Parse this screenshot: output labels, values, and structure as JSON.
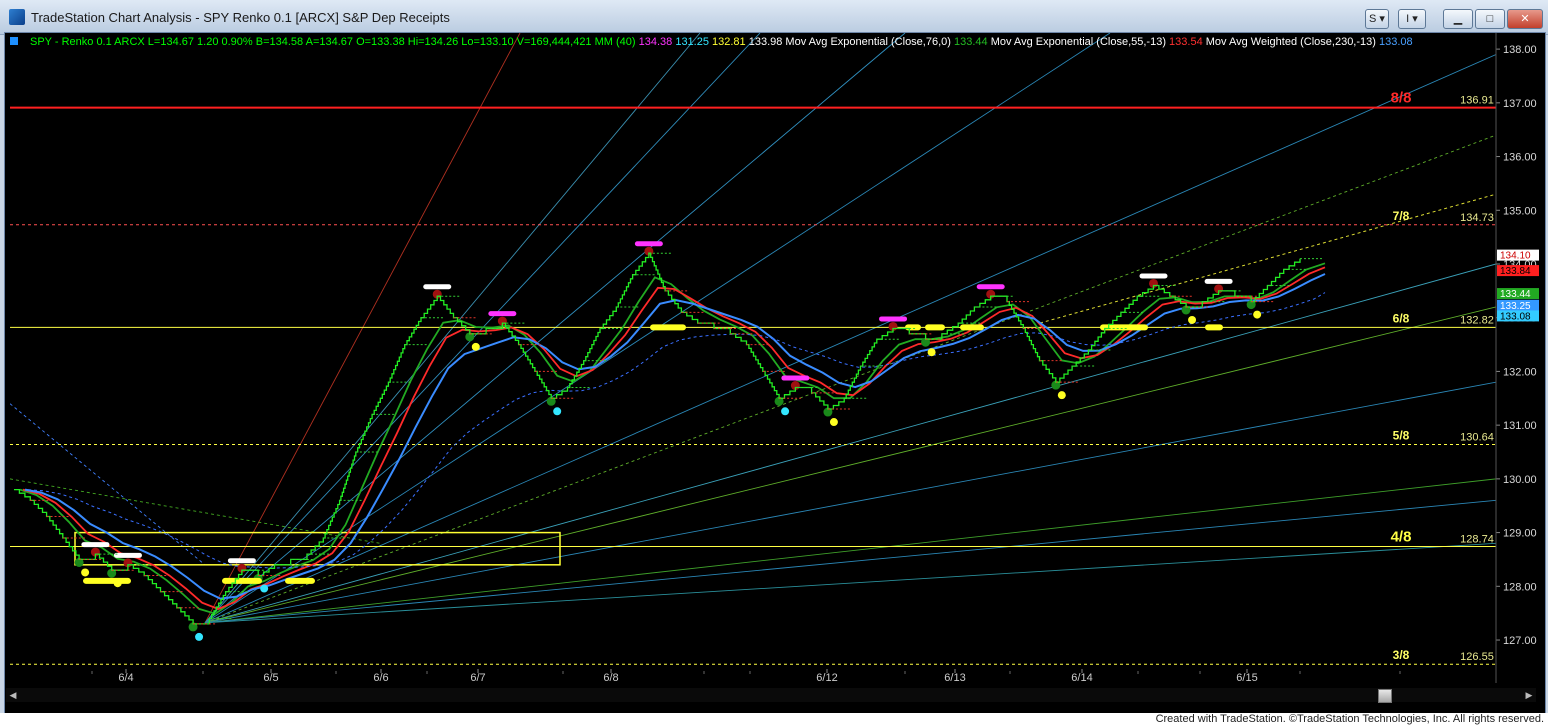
{
  "window": {
    "title": "TradeStation Chart Analysis - SPY Renko 0.1 [ARCX] S&P Dep Receipts",
    "btn_s": "S",
    "btn_i": "I",
    "btn_minimize": "▁",
    "btn_maximize": "□",
    "btn_close": "✕"
  },
  "header": {
    "items": [
      {
        "text": "SPY - Renko 0.1  ARCX  L=134.67  1.20  0.90%  B=134.58  A=134.67  O=133.38  Hi=134.26  Lo=133.10  V=169,444,421  MM (40)",
        "color": "#00ff00"
      },
      {
        "text": "134.38",
        "color": "#ff33ff"
      },
      {
        "text": "131.25",
        "color": "#33e6ff"
      },
      {
        "text": "132.81",
        "color": "#ffff33"
      },
      {
        "text": "133.98",
        "color": "#ffffff"
      },
      {
        "text": "Mov Avg Exponential (Close,76,0)",
        "color": "#ffffff"
      },
      {
        "text": "133.44",
        "color": "#22bb22"
      },
      {
        "text": "Mov Avg Exponential (Close,55,-13)",
        "color": "#ffffff"
      },
      {
        "text": "133.54",
        "color": "#ff3030"
      },
      {
        "text": "Mov Avg Weighted (Close,230,-13)",
        "color": "#ffffff"
      },
      {
        "text": "133.08",
        "color": "#4aa0ff"
      }
    ]
  },
  "murrey": [
    {
      "label": "8/8",
      "value": "136.91",
      "price": 136.91,
      "color": "#ff2020",
      "dash": "0",
      "width": 2,
      "label_color": "#ff2a2a",
      "label_size": 15
    },
    {
      "label": "7/8",
      "value": "134.73",
      "price": 134.73,
      "color": "#ff5050",
      "dash": "3,3",
      "width": 1,
      "label_color": "#ffff66",
      "label_size": 12
    },
    {
      "label": "6/8",
      "value": "132.82",
      "price": 132.82,
      "color": "#ffff44",
      "dash": "0",
      "width": 1,
      "label_color": "#ffff66",
      "label_size": 12
    },
    {
      "label": "5/8",
      "value": "130.64",
      "price": 130.64,
      "color": "#ffff44",
      "dash": "3,3",
      "width": 1,
      "label_color": "#ffff66",
      "label_size": 12
    },
    {
      "label": "4/8",
      "value": "128.74",
      "price": 128.74,
      "color": "#ffff44",
      "dash": "0",
      "width": 1,
      "label_color": "#ffff44",
      "label_size": 15
    },
    {
      "label": "3/8",
      "value": "126.55",
      "price": 126.55,
      "color": "#ffff44",
      "dash": "3,3",
      "width": 1,
      "label_color": "#ffff66",
      "label_size": 12
    }
  ],
  "chart_data": {
    "type": "line",
    "ylim": [
      126.2,
      138.3
    ],
    "y_ticks": [
      "127.00",
      "128.00",
      "129.00",
      "130.00",
      "131.00",
      "132.00",
      "133.00",
      "134.00",
      "135.00",
      "136.00",
      "137.00",
      "138.00"
    ],
    "x_ticks": [
      "6/4",
      "6/5",
      "6/6",
      "6/7",
      "6/8",
      "6/12",
      "6/13",
      "6/14",
      "6/15"
    ],
    "price_tags": [
      {
        "text": "134.10",
        "price": 134.1,
        "bg": "#ffffff",
        "fg": "#cc0000"
      },
      {
        "text": "133.84",
        "price": 133.84,
        "bg": "#ff2020",
        "fg": "#000000"
      },
      {
        "text": "133.44",
        "price": 133.44,
        "bg": "#22aa22",
        "fg": "#ffffff"
      },
      {
        "text": "133.25",
        "price": 133.25,
        "bg": "#3399ff",
        "fg": "#ffffff"
      },
      {
        "text": "133.08",
        "price": 133.08,
        "bg": "#33ccff",
        "fg": "#000000"
      }
    ],
    "series": [
      {
        "values": [
          129.8,
          129.6,
          129.3,
          128.9,
          128.5,
          128.6,
          128.3,
          128.4,
          128.2,
          127.9,
          127.6,
          127.3,
          127.4,
          127.9,
          128.3,
          128.2,
          128.4,
          128.5,
          128.6,
          128.9,
          129.6,
          130.5,
          131.2,
          131.8,
          132.5,
          133.0,
          133.4,
          133.0,
          132.7,
          132.8,
          132.9,
          132.5,
          132.0,
          131.5,
          131.7,
          132.2,
          132.8,
          133.2,
          133.8,
          134.2,
          133.5,
          133.1,
          132.9,
          132.8,
          132.7,
          132.5,
          132.0,
          131.5,
          131.7,
          131.6,
          131.3,
          131.5,
          132.1,
          132.6,
          132.8,
          132.7,
          132.6,
          132.7,
          132.9,
          133.2,
          133.4,
          133.3,
          132.8,
          132.2,
          131.8,
          132.1,
          132.4,
          132.8,
          133.1,
          133.4,
          133.6,
          133.4,
          133.2,
          133.3,
          133.5,
          133.4,
          133.3,
          133.6,
          133.9,
          134.1
        ],
        "color": "#22ff22",
        "width": 1.6,
        "dash": "0"
      }
    ]
  }
}
